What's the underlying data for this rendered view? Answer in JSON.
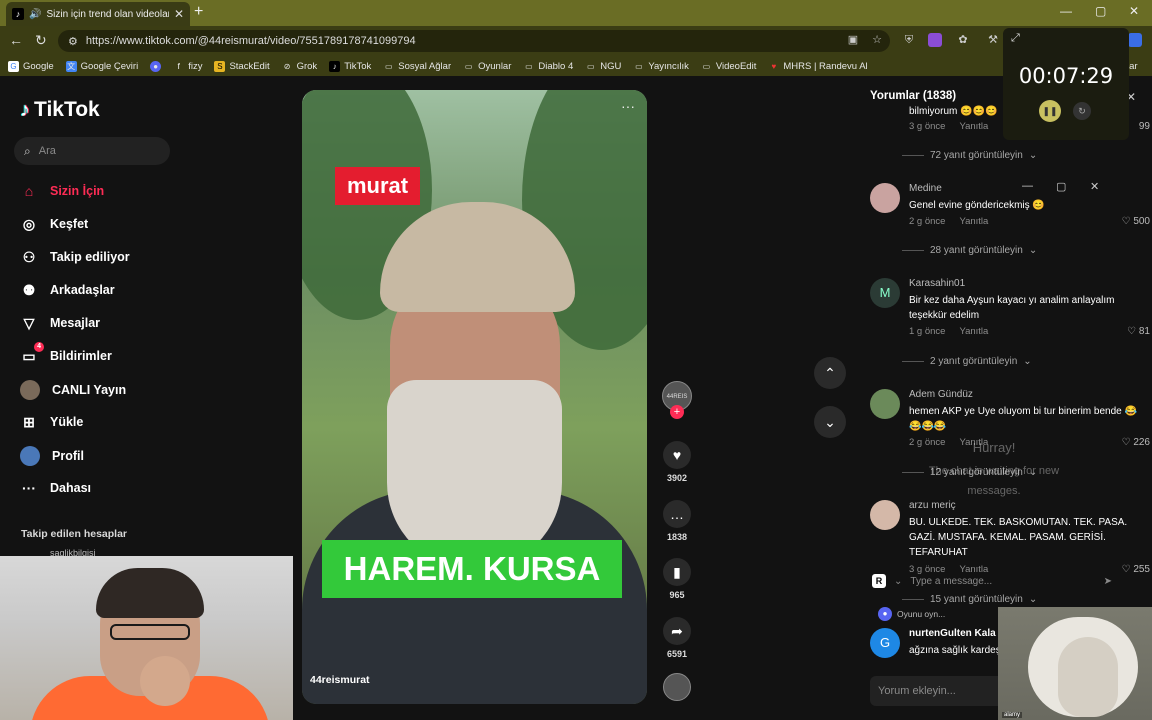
{
  "browser": {
    "tab_title": "Sizin için trend olan videolar",
    "url": "https://www.tiktok.com/@44reismurat/video/7551789178741099794",
    "bookmarks": [
      "Google",
      "Google Çeviri",
      "fizy",
      "StackEdit",
      "Grok",
      "TikTok",
      "Sosyal Ağlar",
      "Oyunlar",
      "Diablo 4",
      "NGU",
      "Yayıncılık",
      "VideoEdit",
      "MHRS | Randevu Al"
    ],
    "bookmarks_more": "lar"
  },
  "timer": {
    "time": "00:07:29"
  },
  "sidebar": {
    "logo": "TikTok",
    "search_placeholder": "Ara",
    "nav": [
      {
        "label": "Sizin İçin",
        "icon": "home-icon"
      },
      {
        "label": "Keşfet",
        "icon": "compass-icon"
      },
      {
        "label": "Takip ediliyor",
        "icon": "following-icon"
      },
      {
        "label": "Arkadaşlar",
        "icon": "friends-icon"
      },
      {
        "label": "Mesajlar",
        "icon": "messages-icon"
      },
      {
        "label": "Bildirimler",
        "icon": "notifications-icon",
        "badge": "4"
      },
      {
        "label": "CANLI Yayın",
        "icon": "live-icon"
      },
      {
        "label": "Yükle",
        "icon": "upload-icon"
      },
      {
        "label": "Profil",
        "icon": "profile-icon"
      },
      {
        "label": "Dahası",
        "icon": "more-icon"
      }
    ],
    "followed_heading": "Takip edilen hesaplar",
    "followed_first": "saglikbilgisi"
  },
  "video": {
    "label_top": "murat",
    "label_bottom": "HAREM. KURSA",
    "username": "44reismurat",
    "likes": "3902",
    "comments": "1838",
    "saves": "965",
    "shares": "6591",
    "avatar_text": "44REIS"
  },
  "comments": {
    "title": "Yorumlar (1838)",
    "top_partial": {
      "text": "bilmiyorum",
      "emojis": "😊😊😊",
      "time": "3 g önce",
      "reply": "Yanıtla",
      "likes": "99",
      "replies": "72 yanıt görüntüleyin"
    },
    "items": [
      {
        "name": "Medine",
        "text": "Genel evine göndericekmiş 😊",
        "time": "2 g önce",
        "reply": "Yanıtla",
        "likes": "500",
        "replies": "28 yanıt görüntüleyin"
      },
      {
        "name": "Karasahin01",
        "text": "Bir kez daha Ayşun kayacı yı analim anlayalım teşekkür edelim",
        "time": "1 g önce",
        "reply": "Yanıtla",
        "likes": "81",
        "replies": "2 yanıt görüntüleyin",
        "avatar_letter": "M"
      },
      {
        "name": "Adem Gündüz",
        "text": "hemen AKP ye Uye oluyom bi tur binerim bende 😂😂😂😂",
        "time": "2 g önce",
        "reply": "Yanıtla",
        "likes": "226",
        "replies": "12 yanıt görüntüleyin"
      },
      {
        "name": "arzu meriç",
        "text": "BU. ULKEDE. TEK. BASKOMUTAN. TEK. PASA. GAZİ. MUSTAFA. KEMAL. PASAM. GERİSİ. TEFARUHAT",
        "time": "3 g önce",
        "reply": "Yanıtla",
        "likes": "255",
        "replies": "15 yanıt görüntüleyin"
      },
      {
        "name": "nurtenGulten Kala",
        "text": "ağzına sağlık kardeş",
        "avatar_letter": "G"
      }
    ],
    "input_placeholder": "Yorum ekleyin..."
  },
  "chat_overlay": {
    "title": "Hurray!",
    "subtitle": "The chat is waiting for new messages.",
    "input_placeholder": "Type a message...",
    "r_label": "R",
    "game_text": "Oyunu oyn..."
  },
  "sheep_cam": {
    "watermark": "alamy"
  }
}
